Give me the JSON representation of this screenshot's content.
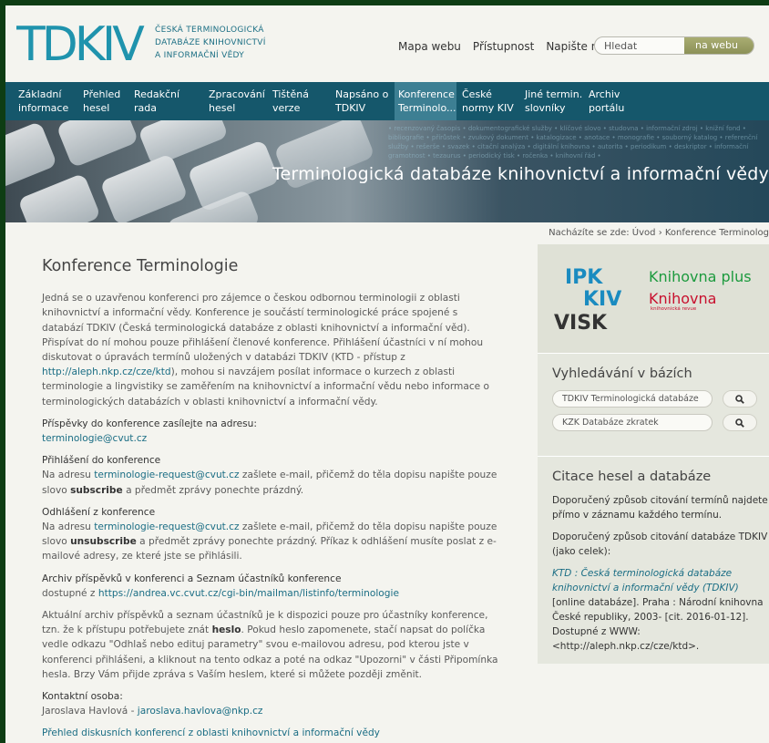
{
  "header": {
    "logo_mark": "TDKIV",
    "logo_lines": [
      "ČESKÁ TERMINOLOGICKÁ",
      "DATABÁZE KNIHOVNICTVÍ",
      "A INFORMAČNÍ VĚDY"
    ],
    "links": [
      "Mapa webu",
      "Přístupnost",
      "Napište nám"
    ],
    "search_placeholder": "Hledat",
    "search_scope": "na webu"
  },
  "nav": {
    "items": [
      {
        "line1": "Základní",
        "line2": "informace"
      },
      {
        "line1": "Přehled",
        "line2": "hesel"
      },
      {
        "line1": "Redakční",
        "line2": "rada"
      },
      {
        "line1": "Zpracování",
        "line2": "hesel"
      },
      {
        "line1": "Tištěná",
        "line2": "verze"
      },
      {
        "line1": "Napsáno o",
        "line2": "TDKIV"
      },
      {
        "line1": "Konference",
        "line2": "Terminolo..."
      },
      {
        "line1": "České",
        "line2": "normy KIV"
      },
      {
        "line1": "Jiné termin.",
        "line2": "slovníky"
      },
      {
        "line1": "Archiv",
        "line2": "portálu"
      }
    ]
  },
  "banner": {
    "title": "Terminologická databáze knihovnictví a informační vědy",
    "keywords": "• recenzovaný časopis • dokumentografické služby • klíčové slovo • studovna • informační zdroj • knižní fond • bibliografie • přírůstek • zvukový dokument • katalogizace • anotace • monografie • souborný katalog • referenční služby • rešerše • svazek • citační analýza • digitální knihovna • autorita • periodikum • deskriptor • informační gramotnost • tezaurus • periodický tisk • ročenka • knihovní řád •"
  },
  "breadcrumb": {
    "prefix": "Nacházíte se zde:",
    "home": "Úvod",
    "current": "Konference Terminolog"
  },
  "main": {
    "title": "Konference Terminologie",
    "intro_1": "Jedná se o uzavřenou konferenci pro zájemce o českou odbornou terminologii z oblasti knihovnictví a informační vědy. Konference je součástí terminologické práce spojené s databází TDKIV (Česká terminologická databáze z oblasti knihovnictví a informační věd). Přispívat do ní mohou pouze přihlášení členové konference. Přihlášení účastníci v ní mohou diskutovat o úpravách termínů uložených v databázi TDKIV (KTD - přístup z ",
    "intro_link": "http://aleph.nkp.cz/cze/ktd",
    "intro_2": "), mohou si navzájem posílat informace o kurzech z oblasti terminologie a lingvistiky se zaměřením na knihovnictví a informační vědu nebo informace o terminologických databázích v oblasti knihovnictví a informační vědy.",
    "contrib_label": "Příspěvky do konference zasílejte na adresu:",
    "contrib_email": "terminologie@cvut.cz",
    "subscribe_label": "Přihlášení do konference",
    "subscribe_pre": "Na adresu ",
    "subscribe_email": "terminologie-request@cvut.cz",
    "subscribe_mid": " zašlete e-mail, přičemž do těla dopisu napište pouze slovo ",
    "subscribe_word": "subscribe",
    "subscribe_post": " a předmět zprávy ponechte prázdný.",
    "unsub_label": "Odhlášení z konference",
    "unsub_pre": "Na adresu ",
    "unsub_email": "terminologie-request@cvut.cz",
    "unsub_mid": " zašlete e-mail, přičemž do těla dopisu napište pouze slovo ",
    "unsub_word": "unsubscribe",
    "unsub_post": " a předmět zprávy ponechte prázdný. Příkaz k odhlášení musíte poslat z e-mailové adresy, ze které jste se přihlásili.",
    "archive_label": "Archiv příspěvků v konferenci a Seznam účastníků konference",
    "archive_pre": "dostupné z ",
    "archive_link": "https://andrea.vc.cvut.cz/cgi-bin/mailman/listinfo/terminologie",
    "info_1": "Aktuální archiv příspěvků a seznam účastníků je k dispozici pouze pro účastníky konference, tzn. že k přístupu potřebujete znát ",
    "info_word": "heslo",
    "info_2": ". Pokud heslo zapomenete, stačí napsat do políčka vedle odkazu \"Odhlaš nebo edituj parametry\" svou e-mailovou adresu, pod kterou jste v konferenci přihlášeni, a kliknout na tento odkaz a poté na odkaz \"Upozorni\" v části Připomínka hesla. Brzy Vám přijde zpráva s Vaším heslem, které si můžete později změnit.",
    "contact_label": "Kontaktní osoba:",
    "contact_name": "Jaroslava Havlová - ",
    "contact_email": "jaroslava.havlova@nkp.cz",
    "overview_link": "Přehled diskusních konferencí z oblasti knihovnictví a informační vědy"
  },
  "sidebar": {
    "logos": {
      "ipk": "IPK",
      "kiv": "KIV",
      "visk": "VISK",
      "knihovna_plus": "Knihovna plus",
      "knihovna": "Knihovna",
      "knihovna_sub": "knihovnická revue"
    },
    "search_title": "Vyhledávání v bázích",
    "db1": "TDKIV Terminologická databáze",
    "db2": "KZK Databáze zkratek",
    "cite_title": "Citace hesel a databáze",
    "cite_p1": "Doporučený způsob citování termínů najdete přímo v záznamu každého termínu.",
    "cite_p2": "Doporučený způsob citování databáze TDKIV (jako celek):",
    "cite_italic": "KTD : Česká terminologická databáze knihovnictví a informační vědy (TDKIV)",
    "cite_rest": " [online databáze]. Praha : Národní knihovna České republiky, 2003- [cit. 2016-01-12]. Dostupné z WWW: <http://aleph.nkp.cz/cze/ktd>."
  }
}
